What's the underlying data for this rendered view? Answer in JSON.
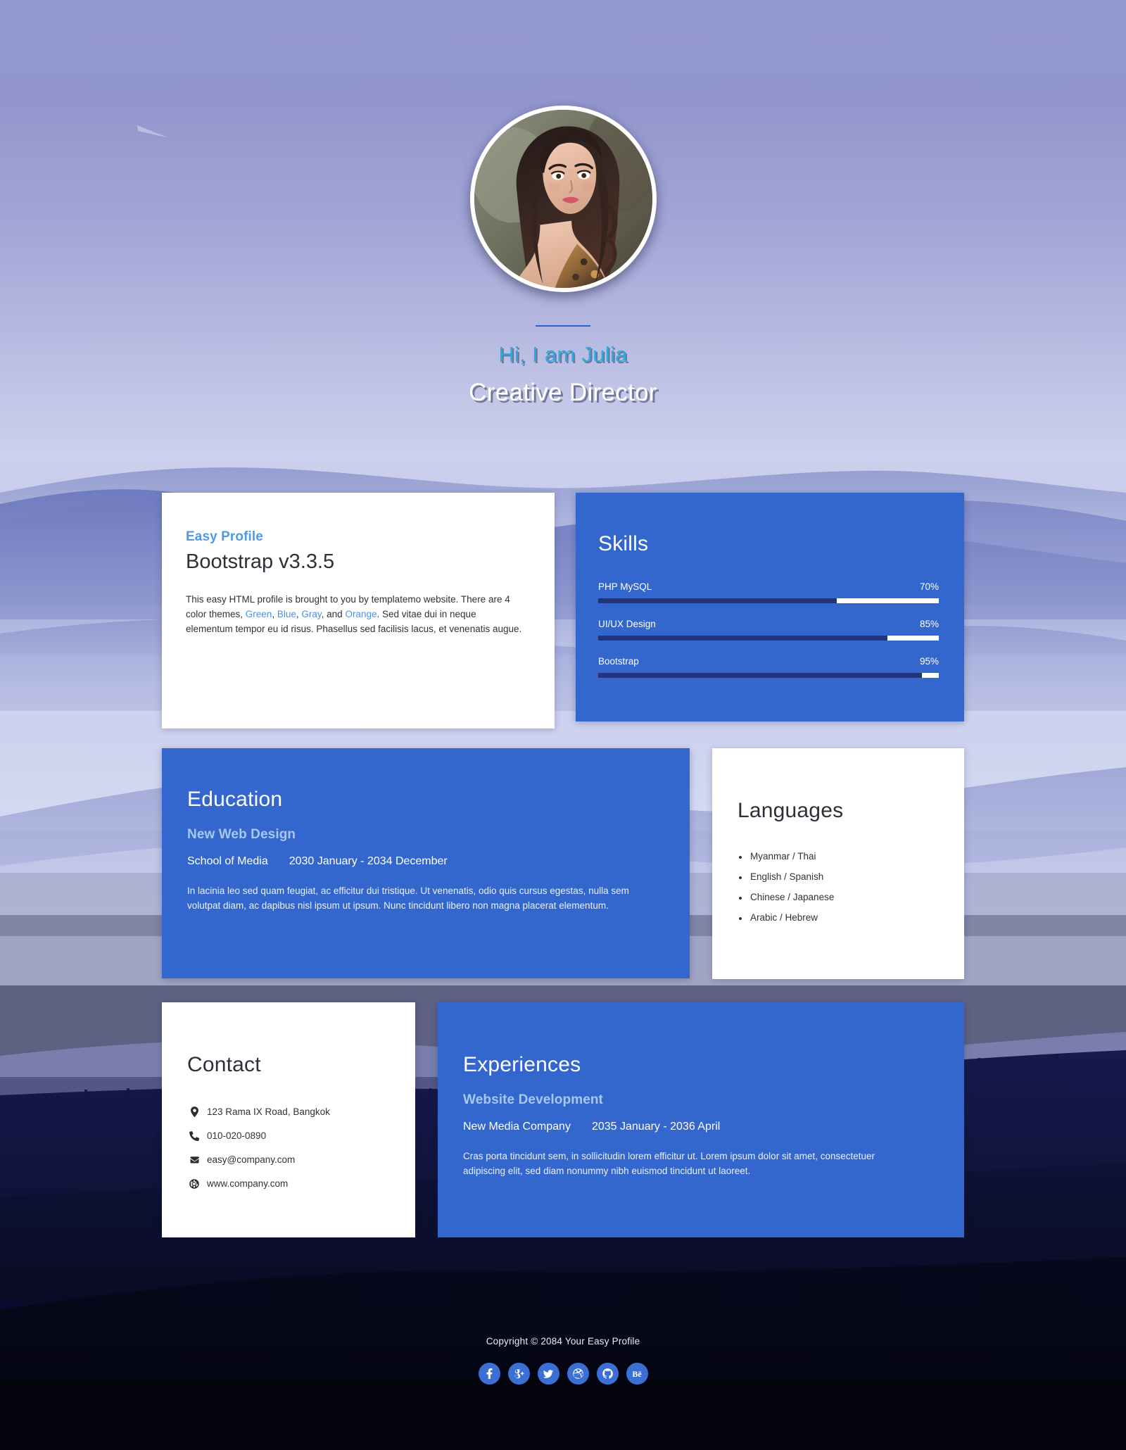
{
  "hero": {
    "avatar_alt": "profile-photo",
    "name": "Hi, I am Julia",
    "role": "Creative Director"
  },
  "colors": {
    "accent_blue": "#3367cd",
    "link_blue": "#4f8fe0",
    "name_cyan": "#2eaae0",
    "skill_fill": "#20357e",
    "social_bg": "#3b6fd4"
  },
  "profile_card": {
    "eyebrow": "Easy Profile",
    "title": "Bootstrap v3.3.5",
    "description_parts": [
      {
        "text": "This easy HTML profile is brought to you by templatemo website. There are 4 color themes, ",
        "link": false
      },
      {
        "text": "Green",
        "link": true
      },
      {
        "text": ", ",
        "link": false
      },
      {
        "text": "Blue",
        "link": true
      },
      {
        "text": ", ",
        "link": false
      },
      {
        "text": "Gray",
        "link": true
      },
      {
        "text": ", and ",
        "link": false
      },
      {
        "text": "Orange",
        "link": true
      },
      {
        "text": ". Sed vitae dui in neque elementum tempor eu id risus. Phasellus sed facilisis lacus, et venenatis augue.",
        "link": false
      }
    ]
  },
  "skills_card": {
    "title": "Skills",
    "items": [
      {
        "label": "PHP MySQL",
        "value": "70%",
        "percent": 70
      },
      {
        "label": "UI/UX Design",
        "value": "85%",
        "percent": 85
      },
      {
        "label": "Bootstrap",
        "value": "95%",
        "percent": 95
      }
    ]
  },
  "education_card": {
    "title": "Education",
    "subtitle": "New Web Design",
    "institution": "School of Media",
    "period": "2030 January - 2034 December",
    "description": "In lacinia leo sed quam feugiat, ac efficitur dui tristique. Ut venenatis, odio quis cursus egestas, nulla sem volutpat diam, ac dapibus nisl ipsum ut ipsum. Nunc tincidunt libero non magna placerat elementum."
  },
  "languages_card": {
    "title": "Languages",
    "items": [
      "Myanmar / Thai",
      "English / Spanish",
      "Chinese / Japanese",
      "Arabic / Hebrew"
    ]
  },
  "contact_card": {
    "title": "Contact",
    "items": [
      {
        "icon": "map-marker-icon",
        "text": "123 Rama IX Road, Bangkok"
      },
      {
        "icon": "phone-icon",
        "text": "010-020-0890"
      },
      {
        "icon": "envelope-icon",
        "text": "easy@company.com"
      },
      {
        "icon": "globe-icon",
        "text": "www.company.com"
      }
    ]
  },
  "experiences_card": {
    "title": "Experiences",
    "subtitle": "Website Development",
    "company": "New Media Company",
    "period": "2035 January - 2036 April",
    "description": "Cras porta tincidunt sem, in sollicitudin lorem efficitur ut. Lorem ipsum dolor sit amet, consectetuer adipiscing elit, sed diam nonummy nibh euismod tincidunt ut laoreet."
  },
  "footer": {
    "copyright": "Copyright © 2084 Your Easy Profile",
    "socials": [
      {
        "icon": "facebook-icon",
        "name": "Facebook"
      },
      {
        "icon": "google-plus-icon",
        "name": "Google Plus"
      },
      {
        "icon": "twitter-icon",
        "name": "Twitter"
      },
      {
        "icon": "dribbble-icon",
        "name": "Dribbble"
      },
      {
        "icon": "github-icon",
        "name": "GitHub"
      },
      {
        "icon": "behance-icon",
        "name": "Behance"
      }
    ]
  }
}
